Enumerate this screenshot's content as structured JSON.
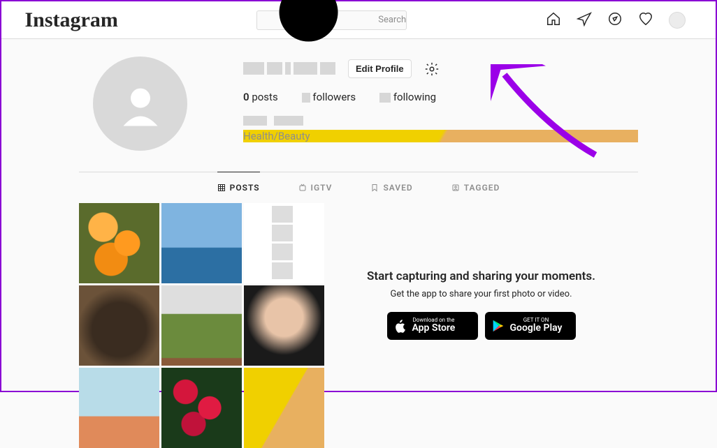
{
  "header": {
    "logo_text": "Instagram",
    "search_placeholder": "Search"
  },
  "profile": {
    "edit_profile_label": "Edit Profile",
    "stats": {
      "posts_count": "0",
      "posts_label": "posts",
      "followers_label": "followers",
      "following_label": "following"
    },
    "category": "Health/Beauty"
  },
  "tabs": {
    "posts": "POSTS",
    "igtv": "IGTV",
    "saved": "SAVED",
    "tagged": "TAGGED"
  },
  "promo": {
    "headline": "Start capturing and sharing your moments.",
    "sub": "Get the app to share your first photo or video.",
    "appstore_small": "Download on the",
    "appstore_big": "App Store",
    "gplay_small": "GET IT ON",
    "gplay_big": "Google Play"
  }
}
